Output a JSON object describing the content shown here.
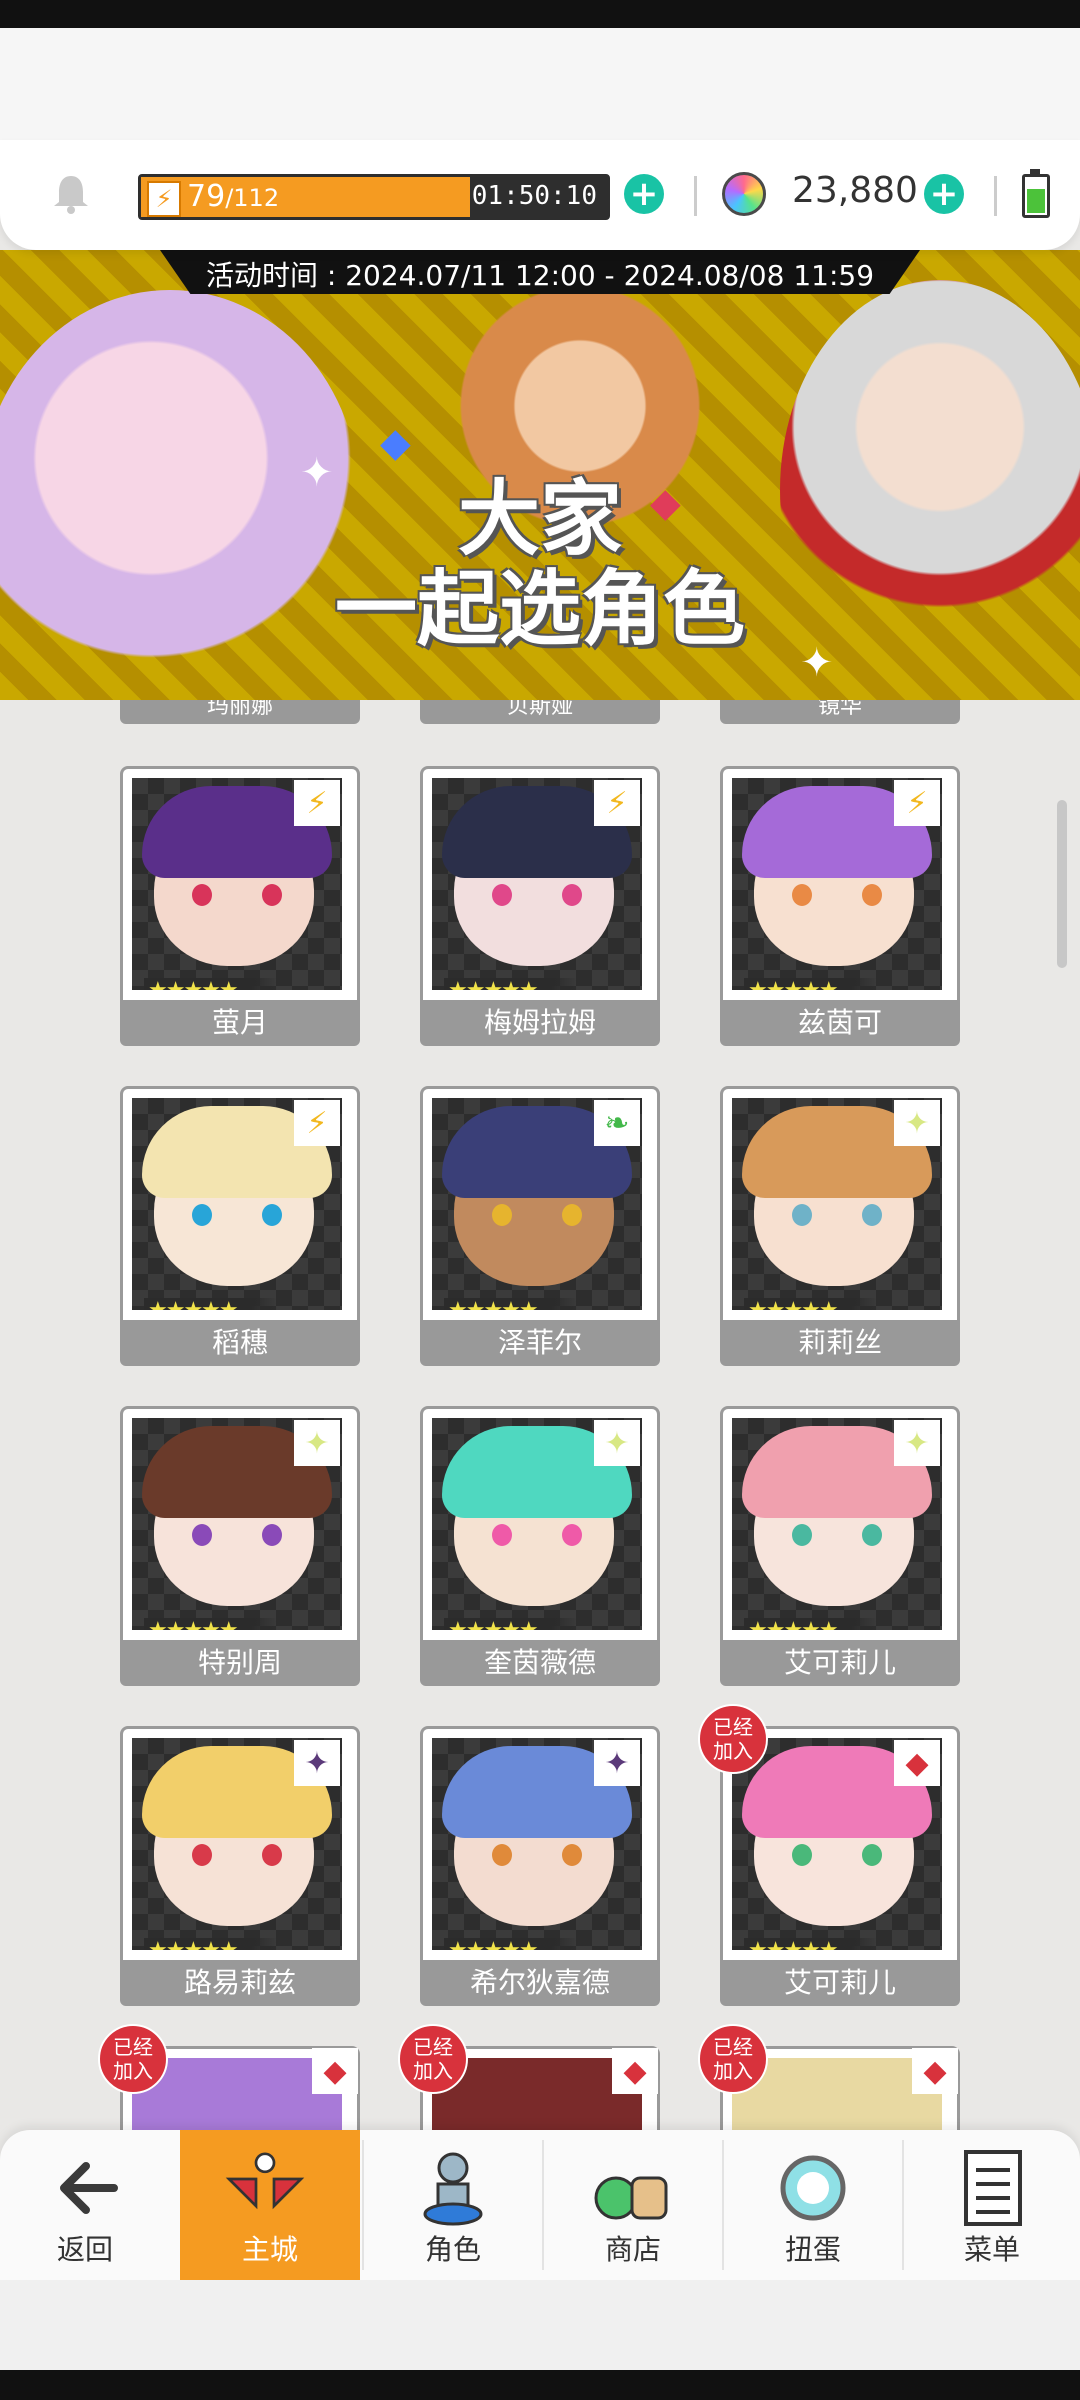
{
  "header": {
    "energy_current": "79",
    "energy_separator": "/",
    "energy_max": "112",
    "energy_progress": 0.705,
    "energy_timer": "01:50:10",
    "gems": "23,880",
    "icons": [
      "bell-icon",
      "lightning-icon",
      "plus-icon",
      "gem-icon",
      "battery-icon"
    ]
  },
  "banner": {
    "event_time": "活动时间 : 2024.07/11 12:00 - 2024.08/08 11:59",
    "title_line1": "大家",
    "title_line2": "一起选角色"
  },
  "roster": {
    "partial_top_labels": [
      "玛丽娜",
      "贝斯娅",
      "镜华"
    ],
    "cards": [
      {
        "name": "萤月",
        "stars": "★★★★★",
        "attribute": "lightning",
        "joined": false
      },
      {
        "name": "梅姆拉姆",
        "stars": "★★★★★",
        "attribute": "lightning",
        "joined": false
      },
      {
        "name": "兹茵可",
        "stars": "★★★★★",
        "attribute": "lightning",
        "joined": false
      },
      {
        "name": "稻穗",
        "stars": "★★★★★",
        "attribute": "lightning",
        "joined": false
      },
      {
        "name": "泽菲尔",
        "stars": "★★★★★",
        "attribute": "wind",
        "joined": false
      },
      {
        "name": "莉莉丝",
        "stars": "★★★★★",
        "attribute": "light",
        "joined": false
      },
      {
        "name": "特别周",
        "stars": "★★★★★",
        "attribute": "light",
        "joined": false
      },
      {
        "name": "奎茵薇德",
        "stars": "★★★★★",
        "attribute": "light",
        "joined": false
      },
      {
        "name": "艾可莉儿",
        "stars": "★★★★★",
        "attribute": "light",
        "joined": false
      },
      {
        "name": "路易莉兹",
        "stars": "★★★★★",
        "attribute": "dark",
        "joined": false
      },
      {
        "name": "希尔狄嘉德",
        "stars": "★★★★★",
        "attribute": "dark",
        "joined": false
      },
      {
        "name": "艾可莉儿",
        "stars": "★★★★★",
        "attribute": "fire",
        "joined": true
      }
    ],
    "joined_badge": "已经\n加入",
    "joined_line1": "已经",
    "joined_line2": "加入"
  },
  "nav": {
    "items": [
      {
        "label": "返回",
        "icon": "back-arrow-icon"
      },
      {
        "label": "主城",
        "icon": "castle-icon"
      },
      {
        "label": "角色",
        "icon": "character-icon"
      },
      {
        "label": "商店",
        "icon": "shop-icon"
      },
      {
        "label": "扭蛋",
        "icon": "gacha-icon"
      },
      {
        "label": "菜单",
        "icon": "menu-list-icon"
      }
    ],
    "active_index": 1
  },
  "colors": {
    "accent": "#f59b21",
    "plus": "#19c3a5",
    "joined_badge": "#d8323c",
    "name_bar": "#999999"
  }
}
